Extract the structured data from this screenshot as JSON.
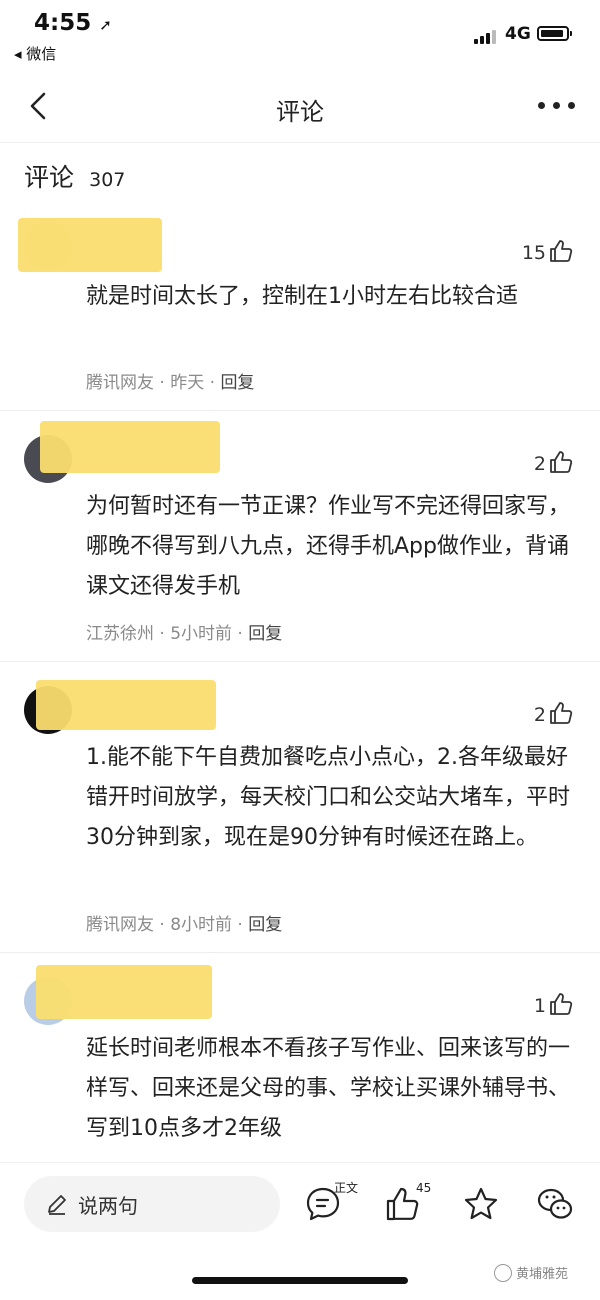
{
  "status_bar": {
    "time": "4:55",
    "location_arrow": "➚",
    "back_app": "◂ 微信",
    "network": "4G"
  },
  "nav": {
    "title": "评论",
    "back_icon": "chevron-left-icon",
    "more_icon": "more-dots-icon"
  },
  "comments_header": {
    "title": "评论",
    "count": "307"
  },
  "comments": [
    {
      "likes": "15",
      "text": "就是时间太长了，控制在1小时左右比较合适",
      "source": "腾讯网友 · 昨天 · ",
      "reply": "回复"
    },
    {
      "likes": "2",
      "text": "为何暂时还有一节正课？作业写不完还得回家写，哪晚不得写到八九点，还得手机App做作业，背诵课文还得发手机",
      "source": "江苏徐州 · 5小时前 · ",
      "reply": "回复"
    },
    {
      "likes": "2",
      "text": "1.能不能下午自费加餐吃点小点心，2.各年级最好错开时间放学，每天校门口和公交站大堵车，平时30分钟到家，现在是90分钟有时候还在路上。",
      "source": "腾讯网友 · 8小时前 · ",
      "reply": "回复"
    },
    {
      "likes": "1",
      "text": "延长时间老师根本不看孩子写作业、回来该写的一样写、回来还是父母的事、学校让买课外辅导书、写到10点多才2年级",
      "source": "",
      "reply": ""
    }
  ],
  "bottom_bar": {
    "input_placeholder": "说两句",
    "article_label": "正文",
    "like_count": "45",
    "icons": [
      "pencil-icon",
      "comment-icon",
      "thumbs-up-icon",
      "star-icon",
      "wechat-icon"
    ]
  },
  "watermark": "黄埔雅苑",
  "colors": {
    "highlight": "#f9dd6e",
    "meta_text": "#8a8a8a",
    "divider": "#eeeeee"
  }
}
